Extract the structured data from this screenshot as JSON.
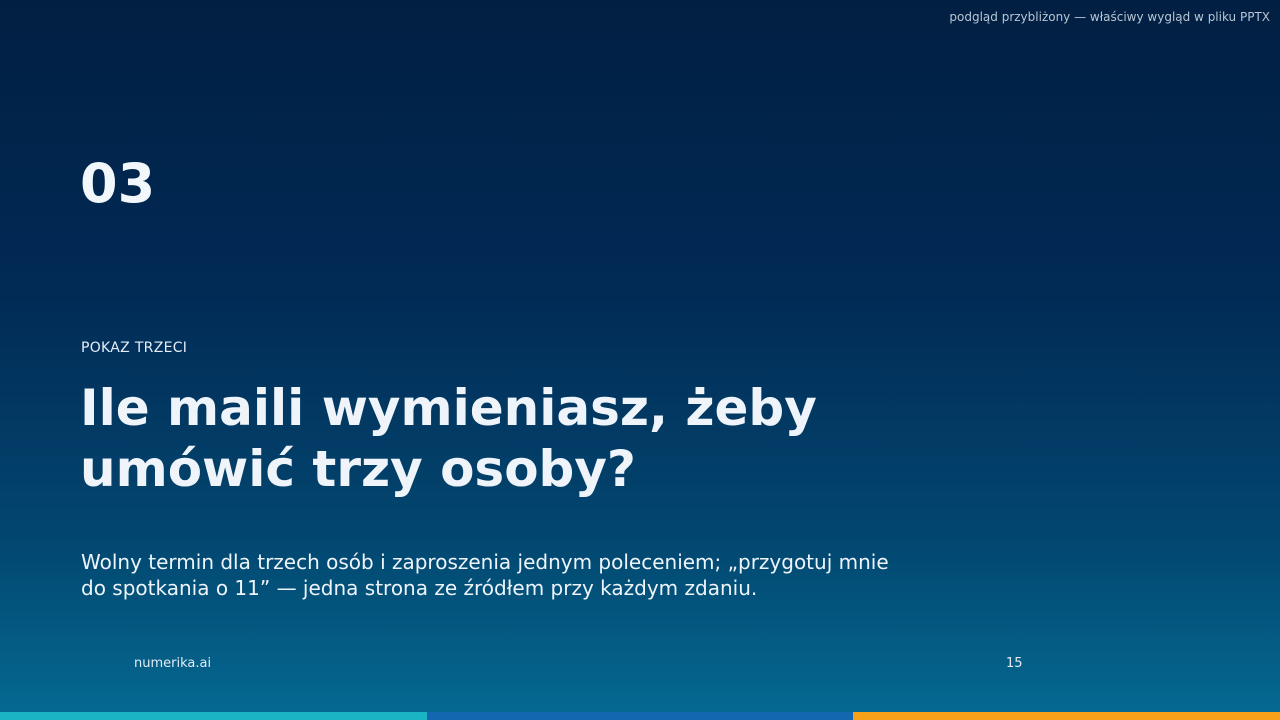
{
  "preview_note": "podgląd przybliżony — właściwy wygląd w pliku PPTX",
  "slide": {
    "section_number": "03",
    "kicker": "POKAZ TRZECI",
    "headline": "Ile maili wymieniasz, żeby umówić trzy osoby?",
    "subtext": "Wolny termin dla trzech osób i zaproszenia jednym poleceniem; „przygotuj mnie do spotkania o 11” — jedna strona ze źródłem przy każdym zdaniu."
  },
  "footer": {
    "brand": "numerika.ai",
    "page_number": "15"
  },
  "colors": {
    "background_top": "#011f42",
    "background_bottom": "#056a92",
    "accent_teal": "#1ab4c4",
    "accent_blue": "#1267b0",
    "accent_orange": "#f7a11a"
  }
}
